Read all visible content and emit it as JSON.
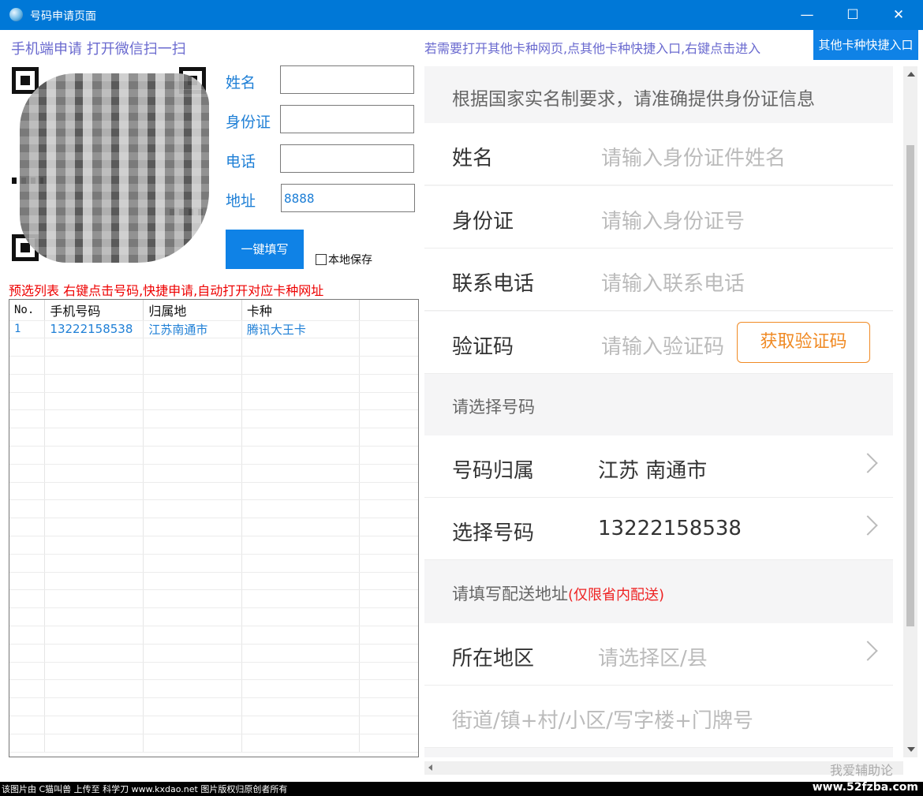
{
  "window": {
    "title": "号码申请页面",
    "controls": {
      "minimize": "—",
      "maximize": "☐",
      "close": "✕"
    }
  },
  "left": {
    "scan_title": "手机端申请  打开微信扫一扫",
    "form": {
      "name_label": "姓名",
      "id_label": "身份证",
      "phone_label": "电话",
      "address_label": "地址",
      "name_value": "",
      "id_value": "",
      "phone_value": "",
      "address_value": "8888"
    },
    "fill_button": "一键填写",
    "local_save_label": "本地保存",
    "red_hint": "预选列表  右键点击号码,快捷申请,自动打开对应卡种网址",
    "grid": {
      "headers": [
        "No.",
        "手机号码",
        "归属地",
        "卡种"
      ],
      "rows": [
        [
          "1",
          "13222158538",
          "江苏南通市",
          "腾讯大王卡"
        ]
      ]
    }
  },
  "right": {
    "top_hint": "若需要打开其他卡种网页,点其他卡种快捷入口,右键点击进入",
    "quick_button": "其他卡种快捷入口",
    "web": {
      "notice": "根据国家实名制要求，请准确提供身份证信息",
      "name_label": "姓名",
      "name_placeholder": "请输入身份证件姓名",
      "id_label": "身份证",
      "id_placeholder": "请输入身份证号",
      "phone_label": "联系电话",
      "phone_placeholder": "请输入联系电话",
      "code_label": "验证码",
      "code_placeholder": "请输入验证码",
      "get_code_button": "获取验证码",
      "select_number_section": "请选择号码",
      "belong_label": "号码归属",
      "belong_value": "江苏 南通市",
      "number_label": "选择号码",
      "number_value": "13222158538",
      "address_section": "请填写配送地址",
      "address_section_note": "(仅限省内配送)",
      "region_label": "所在地区",
      "region_placeholder": "请选择区/县",
      "street_placeholder": "街道/镇+村/小区/写字楼+门牌号"
    }
  },
  "watermark": {
    "right_text": "我爱辅助论",
    "footer_left": "该图片由 C猫叫兽 上传至 科学刀 www.kxdao.net 图片版权归原创者所有",
    "footer_right": "www.52fzba.com"
  },
  "colors": {
    "titlebar": "#0078d7",
    "accent_blue": "#0f82e6",
    "label_blue": "#1e7fd6",
    "hint_purple": "#6a6acf",
    "warning_red": "#e00000",
    "orange": "#f08a24"
  }
}
